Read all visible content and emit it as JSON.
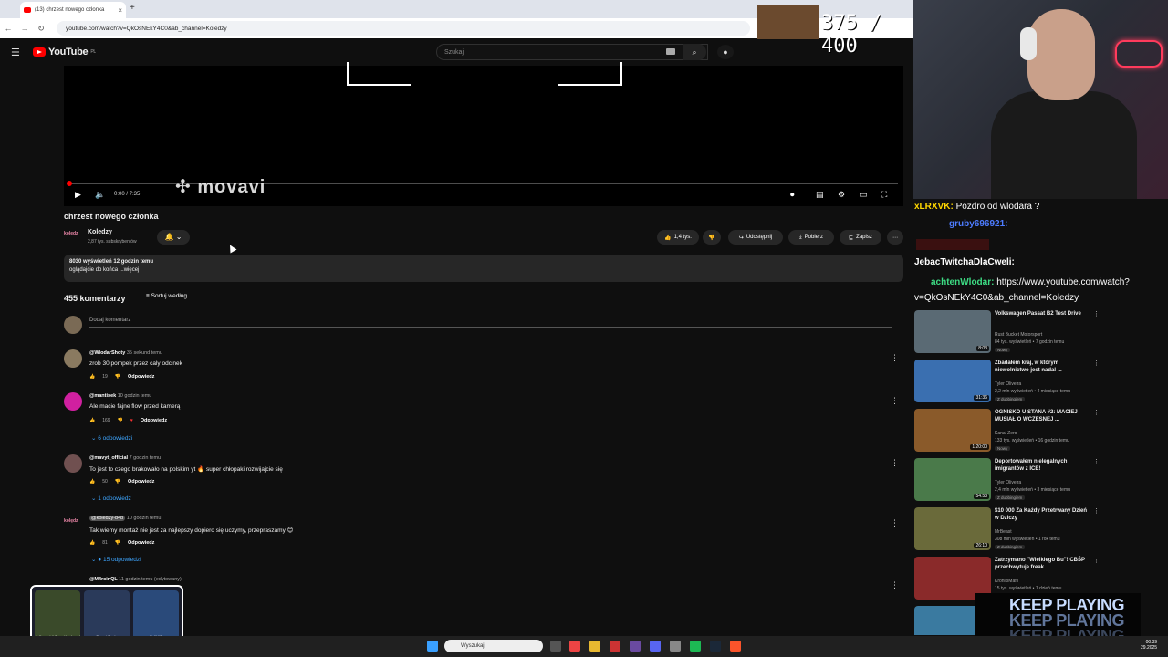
{
  "browser": {
    "tab_title": "(13) chrzest nowego członka",
    "url": "youtube.com/watch?v=QkOsNEkY4C0&ab_channel=Koledzy"
  },
  "youtube": {
    "logo": "YouTube",
    "logo_region": "PL",
    "search_placeholder": "Szukaj"
  },
  "video": {
    "watermark": "movavi",
    "time": "0:00 / 7:35",
    "progress": 0.0
  },
  "meta": {
    "title": "chrzest nowego członka",
    "channel": "Koledzy",
    "channel_logo": "kolędz",
    "subscribers": "2,87 tys. subskrybentów",
    "likes": "1,4 tys.",
    "share": "Udostępnij",
    "download": "Pobierz",
    "save": "Zapisz",
    "desc_line1": "8030 wyświetleń  12 godzin temu",
    "desc_line2": "oglądajcie do końca ...więcej"
  },
  "comments_header": {
    "count": "455 komentarzy",
    "sort": "Sortuj według",
    "add": "Dodaj komentarz"
  },
  "comments": [
    {
      "author": "@WlodarShoty",
      "time": "35 sekund temu",
      "text": "zrob 30 pompek przez caly odcinek",
      "likes": "19",
      "reply": "Odpowiedz",
      "replies": ""
    },
    {
      "author": "@mantisek",
      "time": "10 godzin temu",
      "text": "Ale macie fajne flow przed kamerą",
      "likes": "169",
      "reply": "Odpowiedz",
      "replies": "6 odpowiedzi"
    },
    {
      "author": "@mavyt_official",
      "time": "7 godzin temu",
      "text": "To jest to czego brakowało na polskim yt 🔥 super chłopaki rozwijajcie się",
      "likes": "50",
      "reply": "Odpowiedz",
      "replies": "1 odpowiedź"
    },
    {
      "author": "@koledzy-b4b",
      "time": "10 godzin temu",
      "text": "Tak wiemy montaż nie jest za najlepszy dopiero się uczymy, przepraszamy 😊",
      "likes": "81",
      "reply": "Odpowiedz",
      "replies": "15 odpowiedzi"
    },
    {
      "author": "@M4rcinQL",
      "time": "11 godzin temu (edytowany)",
      "text": "",
      "likes": "",
      "reply": "",
      "replies": ""
    }
  ],
  "stream": {
    "counter": "375 / 400"
  },
  "chat": [
    {
      "name": "xLRXVK:",
      "text": " Pozdro od wlodara ?",
      "color": "#ffd700"
    },
    {
      "name": "gruby696921:",
      "text": "",
      "color": "#4d7cff"
    },
    {
      "name": "",
      "text": "",
      "color": "#ff4d4d"
    },
    {
      "name": "JebacTwitchaDlaCweli:",
      "text": "",
      "color": "#ffffff"
    },
    {
      "name": "achtenWlodar:",
      "text": " https://www.youtube.com/watch?",
      "color": "#3ddc84"
    },
    {
      "name": "",
      "text": "v=QkOsNEkY4C0&ab_channel=Koledzy",
      "color": "#ffffff"
    }
  ],
  "recommendations": [
    {
      "title": "Volkswagen Passat B2 Test Drive",
      "channel": "Rust Bucket Motorsport",
      "stats": "84 tys. wyświetleń • 7 godzin temu",
      "badge": "Nowy",
      "duration": "8:03",
      "thumb": "#5a6a74"
    },
    {
      "title": "Zbadałem kraj, w którym niewolnictwo jest nadal ...",
      "channel": "Tyler Oliveira",
      "stats": "2,2 mln wyświetleń • 4 miesiące temu",
      "badge": "Z dubbingiem",
      "duration": "31:36",
      "thumb": "#3a6fb0"
    },
    {
      "title": "OGNISKO U STANA #2: MACIEJ MUSIAŁ O WCZESNEJ ...",
      "channel": "Kanał Zero",
      "stats": "133 tys. wyświetleń • 16 godzin temu",
      "badge": "Nowy",
      "duration": "1:20:00",
      "thumb": "#8a5a2a"
    },
    {
      "title": "Deportowałem nielegalnych imigrantów z ICE!",
      "channel": "Tyler Oliveira",
      "stats": "2,4 mln wyświetleń • 3 miesiące temu",
      "badge": "Z dubbingiem",
      "duration": "54:53",
      "thumb": "#4a7a4a"
    },
    {
      "title": "$10 000 Za Każdy Przetrwany Dzień w Dziczy",
      "channel": "MrBeast",
      "stats": "308 mln wyświetleń • 1 rok temu",
      "badge": "Z dubbingiem",
      "duration": "26:10",
      "thumb": "#6a6a3a"
    },
    {
      "title": "Zatrzymano \"Wielkiego Bu\"! CBŚP przechwytuje freak ...",
      "channel": "KronikiMafii",
      "stats": "15 tys. wyświetleń • 1 dzień temu",
      "badge": "",
      "duration": "",
      "thumb": "#8a2a2a"
    },
    {
      "title": "",
      "channel": "",
      "stats": "",
      "badge": "",
      "duration": "",
      "thumb": "#3a7aa0"
    }
  ],
  "popup": [
    "★ Karambit Case Hardened",
    "Desert Eagle",
    "Galil AR"
  ],
  "taskbar": {
    "search": "Wyszukaj",
    "time": "00:39",
    "date": "29.2025"
  },
  "overlay": {
    "keep_playing": "KEEP PLAYING"
  }
}
